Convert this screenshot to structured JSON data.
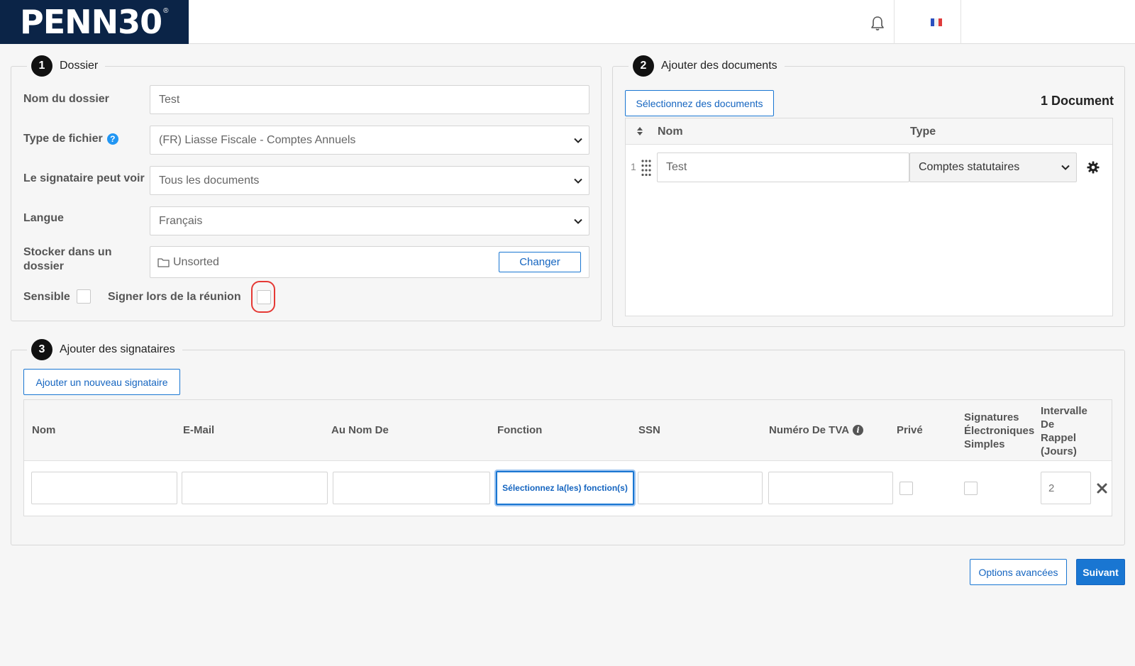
{
  "header": {
    "logo_text": "PENN30",
    "logo_reg": "®",
    "bell_icon": "bell-icon",
    "flag_icon": "flag-fr-icon"
  },
  "dossier": {
    "step": "1",
    "title": "Dossier",
    "name_label": "Nom du dossier",
    "name_value": "Test",
    "filetype_label": "Type de fichier",
    "filetype_value": "(FR) Liasse Fiscale - Comptes Annuels",
    "visibility_label": "Le signataire peut voir",
    "visibility_value": "Tous les documents",
    "language_label": "Langue",
    "language_value": "Français",
    "store_label_1": "Stocker dans un",
    "store_label_2": "dossier",
    "store_value": "Unsorted",
    "change_button": "Changer",
    "sensitive_label": "Sensible",
    "meeting_label": "Signer lors de la réunion"
  },
  "documents": {
    "step": "2",
    "title": "Ajouter des documents",
    "select_button": "Sélectionnez des documents",
    "count": "1 Document",
    "col_name": "Nom",
    "col_type": "Type",
    "rows": [
      {
        "index": "1",
        "name": "Test",
        "type": "Comptes statutaires"
      }
    ]
  },
  "signers": {
    "step": "3",
    "title": "Ajouter des signataires",
    "add_button": "Ajouter un nouveau signataire",
    "columns": {
      "name": "Nom",
      "email": "E-Mail",
      "on_behalf": "Au Nom De",
      "role": "Fonction",
      "ssn": "SSN",
      "vat": "Numéro De TVA",
      "private": "Privé",
      "simple_sig_1": "Signatures",
      "simple_sig_2": "Électroniques",
      "simple_sig_3": "Simples",
      "reminder_1": "Intervalle",
      "reminder_2": "De",
      "reminder_3": "Rappel",
      "reminder_4": "(Jours)"
    },
    "row": {
      "role_button": "Sélectionnez la(les) fonction(s)",
      "reminder_value": "2"
    }
  },
  "footer": {
    "advanced_button": "Options avancées",
    "next_button": "Suivant"
  },
  "colors": {
    "brand_navy": "#0b2447",
    "accent_blue": "#1976d2",
    "highlight_red": "#e53935"
  }
}
